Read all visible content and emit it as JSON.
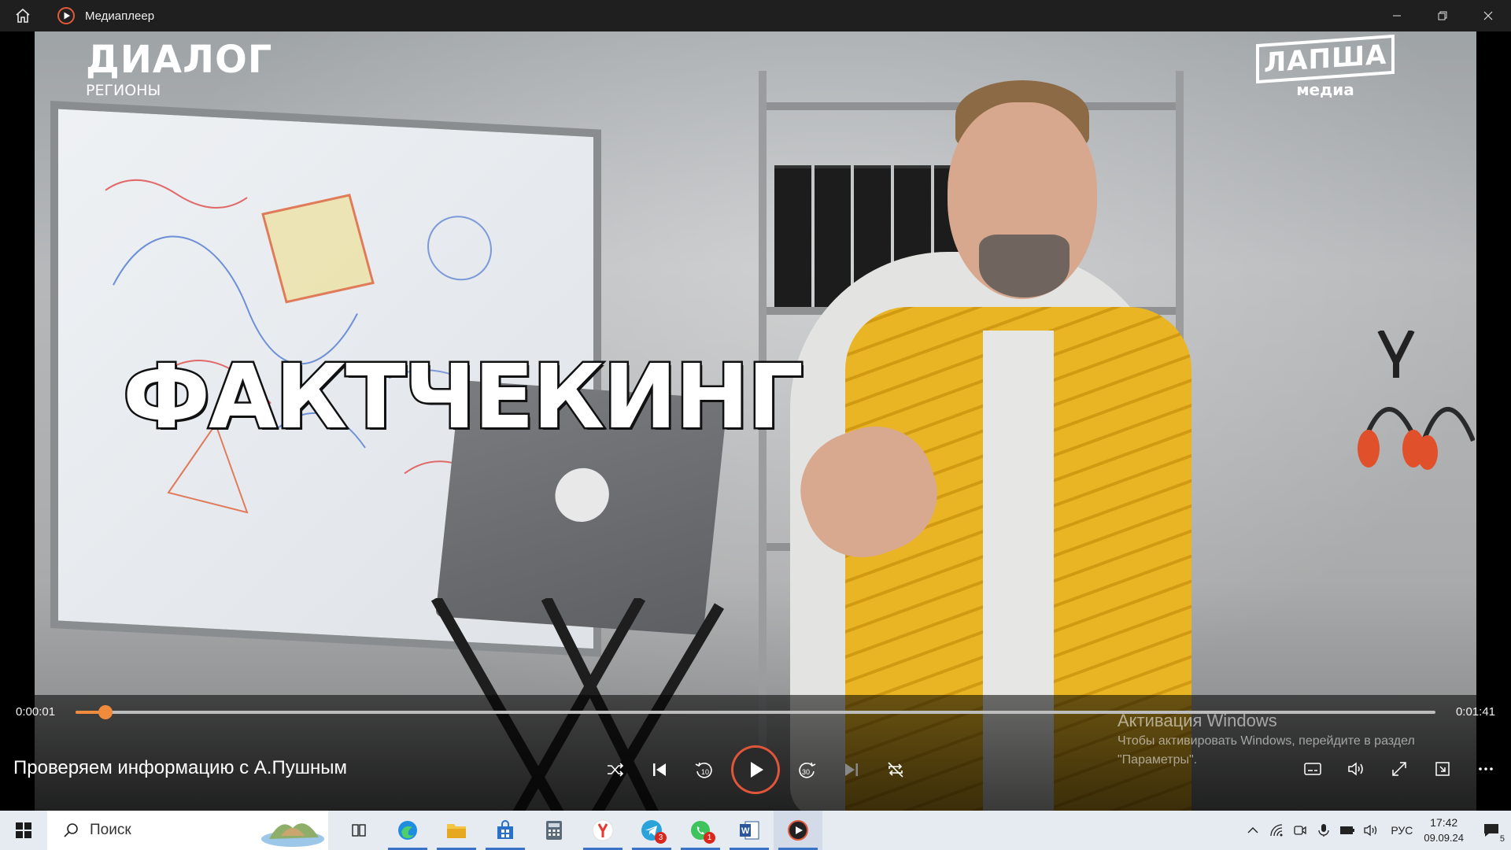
{
  "window": {
    "title": "Медиаплеер",
    "icons": [
      "home-icon",
      "media-player-icon",
      "minimize-icon",
      "restore-icon",
      "close-icon"
    ]
  },
  "video": {
    "logo_left_line1": "ДИАЛОГ",
    "logo_left_line2": "РЕГИОНЫ",
    "logo_right_line1": "ЛАПША",
    "logo_right_line2": "медиа",
    "headline": "ФАКТЧЕКИНГ"
  },
  "player": {
    "current_time": "0:00:01",
    "total_time": "0:01:41",
    "progress_fraction": 0.022,
    "media_title": "Проверяем информацию с А.Пушным",
    "center_controls": [
      "shuffle-icon",
      "previous-icon",
      "skip-back-10-icon",
      "play-icon",
      "skip-forward-30-icon",
      "next-icon",
      "repeat-off-icon"
    ],
    "right_controls": [
      "subtitles-icon",
      "volume-icon",
      "fullscreen-icon",
      "mini-player-icon",
      "more-icon"
    ],
    "accent_color": "#f08a3c"
  },
  "activation": {
    "title": "Активация Windows",
    "line1": "Чтобы активировать Windows, перейдите в раздел",
    "line2": "\"Параметры\"."
  },
  "taskbar": {
    "search_placeholder": "Поиск",
    "apps": [
      {
        "name": "task-view-icon"
      },
      {
        "name": "edge-icon"
      },
      {
        "name": "file-explorer-icon"
      },
      {
        "name": "store-icon"
      },
      {
        "name": "calculator-icon"
      },
      {
        "name": "yandex-browser-icon"
      },
      {
        "name": "telegram-icon",
        "badge": "3"
      },
      {
        "name": "whatsapp-icon",
        "badge": "1"
      },
      {
        "name": "word-icon"
      },
      {
        "name": "media-player-icon"
      }
    ],
    "language": "РУС",
    "time": "17:42",
    "date": "09.09.24",
    "notifications": "5"
  }
}
